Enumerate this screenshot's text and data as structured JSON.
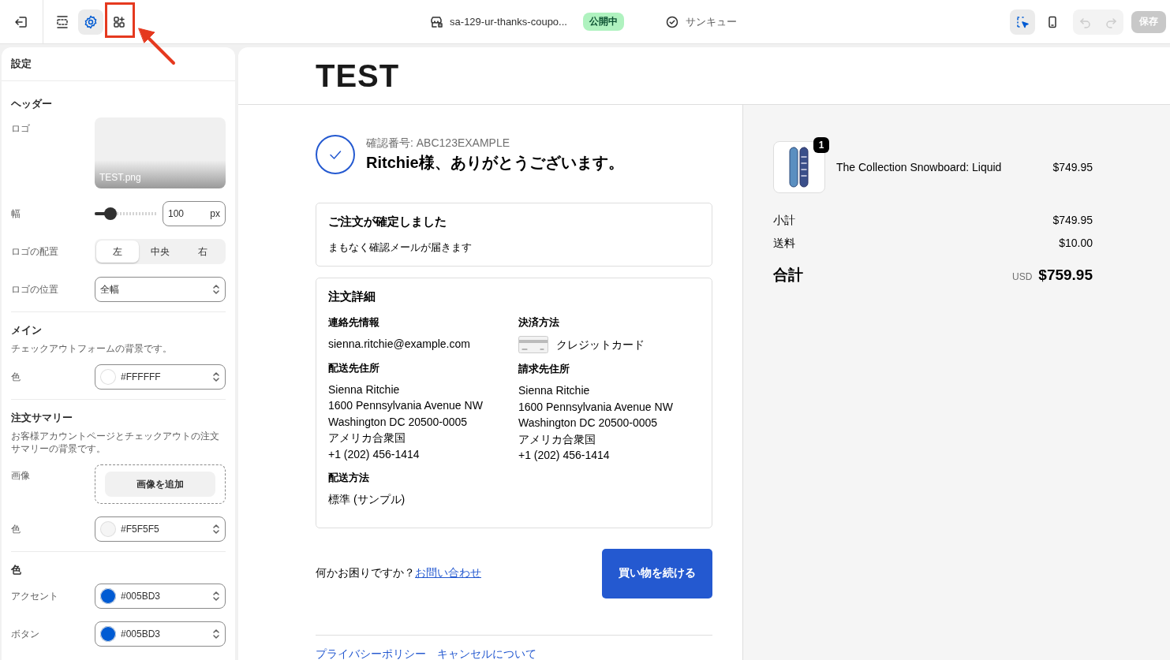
{
  "toolbar": {
    "view_tabs": [
      {
        "kind": "sections",
        "selected": false
      },
      {
        "kind": "settings",
        "selected": true
      },
      {
        "kind": "apps",
        "selected": false
      }
    ],
    "page_name": "sa-129-ur-thanks-coupo...",
    "status_badge": "公開中",
    "template": "サンキュー",
    "inspector": {
      "selected": true
    },
    "undo": {
      "disabled": true
    },
    "redo": {
      "disabled": true
    },
    "save": {
      "label": "保存",
      "disabled": true
    }
  },
  "settings": {
    "title": "設定",
    "sections": [
      {
        "title": "ヘッダー",
        "fields": [
          {
            "kind": "image",
            "label": "ロゴ",
            "filename": "TEST.png"
          },
          {
            "kind": "slider",
            "label": "幅",
            "level": 0.25,
            "value": "100",
            "unit": "px"
          },
          {
            "kind": "segmented",
            "label": "ロゴの配置",
            "options": [
              {
                "label": "左",
                "selected": true
              },
              {
                "label": "中央",
                "selected": false
              },
              {
                "label": "右",
                "selected": false
              }
            ]
          },
          {
            "kind": "select",
            "label": "ロゴの位置",
            "value": "全幅"
          }
        ]
      },
      {
        "title": "メイン",
        "description": "チェックアウトフォームの背景です。",
        "fields": [
          {
            "kind": "color",
            "label": "色",
            "value": "#FFFFFF",
            "color": "#ffffff"
          }
        ]
      },
      {
        "title": "注文サマリー",
        "description": "お客様アカウントページとチェックアウトの注文サマリーの背景です。",
        "fields": [
          {
            "kind": "upload",
            "label": "画像",
            "button": "画像を追加"
          },
          {
            "kind": "color",
            "label": "色",
            "value": "#F5F5F5",
            "color": "#f5f5f5"
          }
        ]
      },
      {
        "title": "色",
        "fields": [
          {
            "kind": "color",
            "label": "アクセント",
            "value": "#005BD3",
            "color": "#005bd3"
          },
          {
            "kind": "color",
            "label": "ボタン",
            "value": "#005BD3",
            "color": "#005bd3"
          }
        ]
      }
    ]
  },
  "preview": {
    "logo": "TEST",
    "confirmation_number": "確認番号: ABC123EXAMPLE",
    "greeting": "Ritchie様、ありがとうございます。",
    "status_card": {
      "title": "ご注文が確定しました",
      "message": "まもなく確認メールが届きます"
    },
    "details": {
      "title": "注文詳細",
      "columns": [
        [
          {
            "heading": "連絡先情報",
            "lines": [
              "sienna.ritchie@example.com"
            ]
          },
          {
            "heading": "配送先住所",
            "lines": [
              "Sienna Ritchie",
              "1600 Pennsylvania Avenue NW",
              "Washington DC 20500-0005",
              "アメリカ合衆国",
              "+1 (202) 456-1414"
            ]
          },
          {
            "heading": "配送方法",
            "lines": [
              "標準 (サンプル)"
            ]
          }
        ],
        [
          {
            "heading": "決済方法",
            "payment": "クレジットカード"
          },
          {
            "heading": "請求先住所",
            "lines": [
              "Sienna Ritchie",
              "1600 Pennsylvania Avenue NW",
              "Washington DC 20500-0005",
              "アメリカ合衆国",
              "+1 (202) 456-1414"
            ]
          }
        ]
      ]
    },
    "help_text": "何かお困りですか？",
    "help_link": "お問い合わせ",
    "continue_button": "買い物を続ける",
    "footer_links": [
      "プライバシーポリシー",
      "キャンセルについて"
    ],
    "summary": {
      "items": [
        {
          "quantity": "1",
          "name": "The Collection Snowboard: Liquid",
          "price": "$749.95"
        }
      ],
      "rows": [
        {
          "label": "小計",
          "value": "$749.95"
        },
        {
          "label": "送料",
          "value": "$10.00"
        }
      ],
      "total_label": "合計",
      "currency": "USD",
      "total": "$759.95"
    }
  }
}
